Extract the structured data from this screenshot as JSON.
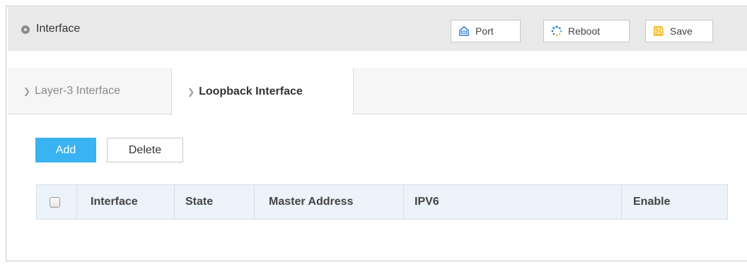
{
  "header": {
    "title": "Interface",
    "title_icon": "circle-dot-icon",
    "buttons": {
      "port": {
        "label": "Port",
        "icon": "port-icon"
      },
      "reboot": {
        "label": "Reboot",
        "icon": "reboot-spinner-icon"
      },
      "save": {
        "label": "Save",
        "icon": "save-icon"
      }
    }
  },
  "tabs": [
    {
      "label": "Layer-3 Interface",
      "active": false
    },
    {
      "label": "Loopback Interface",
      "active": true
    }
  ],
  "actions": {
    "add_label": "Add",
    "delete_label": "Delete"
  },
  "table": {
    "columns": [
      "Interface",
      "State",
      "Master Address",
      "IPV6",
      "Enable"
    ],
    "rows": []
  },
  "colors": {
    "accent": "#39b3f1",
    "header_bg": "#e9e9e9",
    "table_header_bg": "#edf3fa",
    "icon_blue": "#2a7fd4",
    "icon_yellow": "#f2b21b"
  }
}
